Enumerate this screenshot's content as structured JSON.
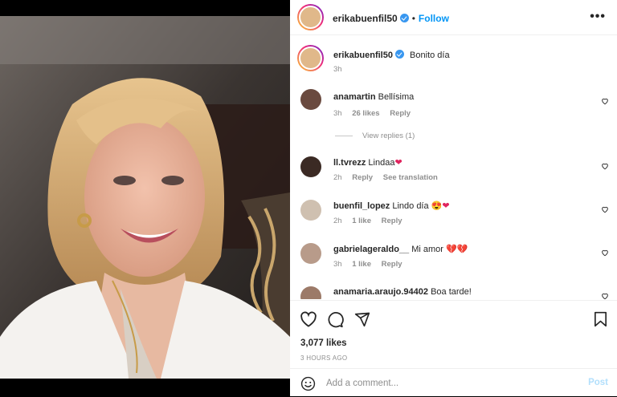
{
  "header": {
    "username": "erikabuenfil50",
    "verified_icon": "verified-badge-icon",
    "separator": "•",
    "follow_label": "Follow",
    "more_icon": "more-options-icon",
    "more_label": "•••"
  },
  "caption": {
    "username": "erikabuenfil50",
    "text": "Bonito día",
    "time": "3h"
  },
  "comments": [
    {
      "username": "anamartin",
      "text": "Bellísima",
      "time": "3h",
      "likes": "26 likes",
      "reply": "Reply",
      "view_replies": "View replies (1)"
    },
    {
      "username": "ll.tvrezz",
      "text": "Lindaa",
      "emoji": "❤",
      "time": "2h",
      "reply": "Reply",
      "translation": "See translation"
    },
    {
      "username": "buenfil_lopez",
      "text": "Lindo día",
      "emoji": "😍❤",
      "time": "2h",
      "likes": "1 like",
      "reply": "Reply"
    },
    {
      "username": "gabrielageraldo__",
      "text": "Mi amor",
      "emoji": "💔💔",
      "time": "3h",
      "likes": "1 like",
      "reply": "Reply"
    },
    {
      "username": "anamaria.araujo.94402",
      "text": "Boa tarde!"
    }
  ],
  "actions": {
    "like_icon": "heart-icon",
    "comment_icon": "comment-icon",
    "share_icon": "share-icon",
    "save_icon": "bookmark-icon"
  },
  "likes_count": "3,077 likes",
  "posted_ago": "3 HOURS AGO",
  "add_comment": {
    "emoji_icon": "emoji-icon",
    "placeholder": "Add a comment...",
    "post_label": "Post"
  },
  "colors": {
    "accent": "#0095f6",
    "post_disabled": "#b2dffc",
    "muted": "#8e8e8e",
    "heart_red": "#e0245e"
  }
}
